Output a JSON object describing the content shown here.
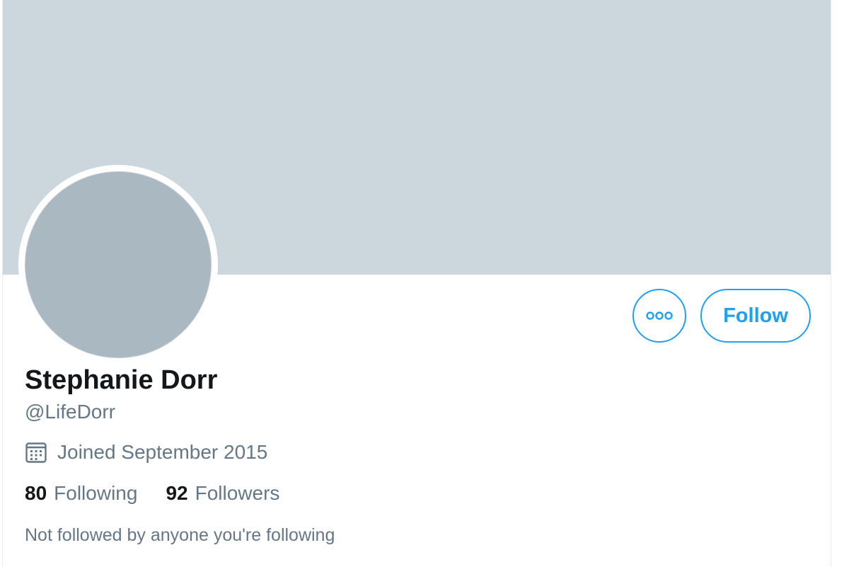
{
  "profile": {
    "display_name": "Stephanie Dorr",
    "handle": "@LifeDorr",
    "joined": "Joined September 2015",
    "following_count": "80",
    "following_label": "Following",
    "followers_count": "92",
    "followers_label": "Followers",
    "followed_by_note": "Not followed by anyone you're following"
  },
  "actions": {
    "follow_label": "Follow",
    "more_icon": "more-dots-icon"
  },
  "colors": {
    "banner": "#ccd6dd",
    "avatar": "#aab8c2",
    "accent": "#1da1f2",
    "primary_text": "#14171a",
    "secondary_text": "#657786"
  }
}
